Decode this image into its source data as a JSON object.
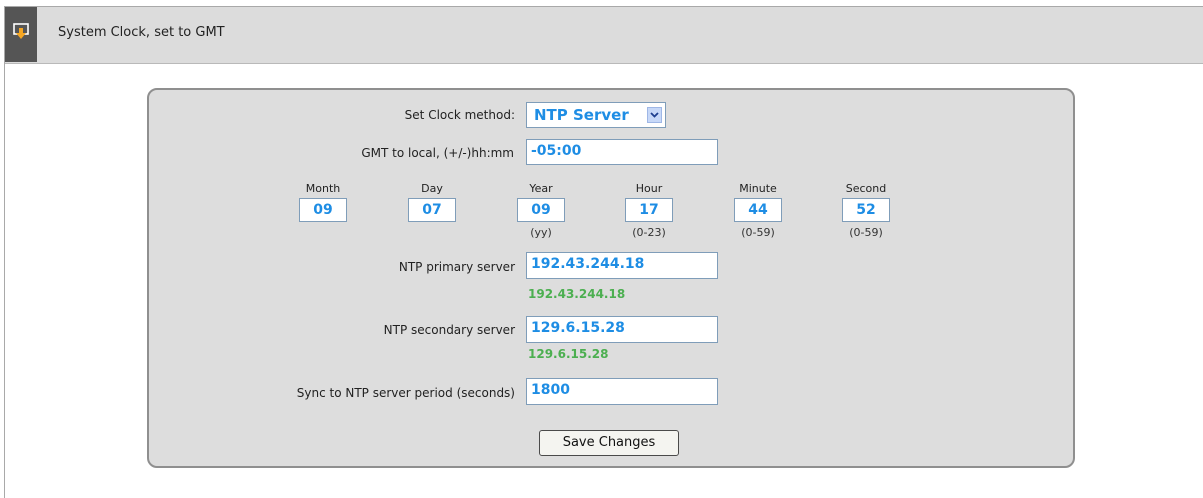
{
  "header": {
    "title": "System Clock, set to GMT",
    "icon": "download-tray-icon"
  },
  "form": {
    "method_label": "Set Clock method:",
    "method_value": "NTP Server",
    "gmt_label": "GMT to local, (+/-)hh:mm",
    "gmt_value": "-05:00",
    "datetime": [
      {
        "label": "Month",
        "value": "09",
        "hint": ""
      },
      {
        "label": "Day",
        "value": "07",
        "hint": ""
      },
      {
        "label": "Year",
        "value": "09",
        "hint": "(yy)"
      },
      {
        "label": "Hour",
        "value": "17",
        "hint": "(0-23)"
      },
      {
        "label": "Minute",
        "value": "44",
        "hint": "(0-59)"
      },
      {
        "label": "Second",
        "value": "52",
        "hint": "(0-59)"
      }
    ],
    "ntp_primary_label": "NTP primary server",
    "ntp_primary_value": "192.43.244.18",
    "ntp_primary_current": "192.43.244.18",
    "ntp_secondary_label": "NTP secondary server",
    "ntp_secondary_value": "129.6.15.28",
    "ntp_secondary_current": "129.6.15.28",
    "sync_label": "Sync to NTP server period (seconds)",
    "sync_value": "1800",
    "save_label": "Save Changes"
  },
  "colors": {
    "value_text": "#1e8de4",
    "current_text": "#4caf50",
    "panel_bg": "#dddddd",
    "header_bg": "#dcdcdc"
  }
}
